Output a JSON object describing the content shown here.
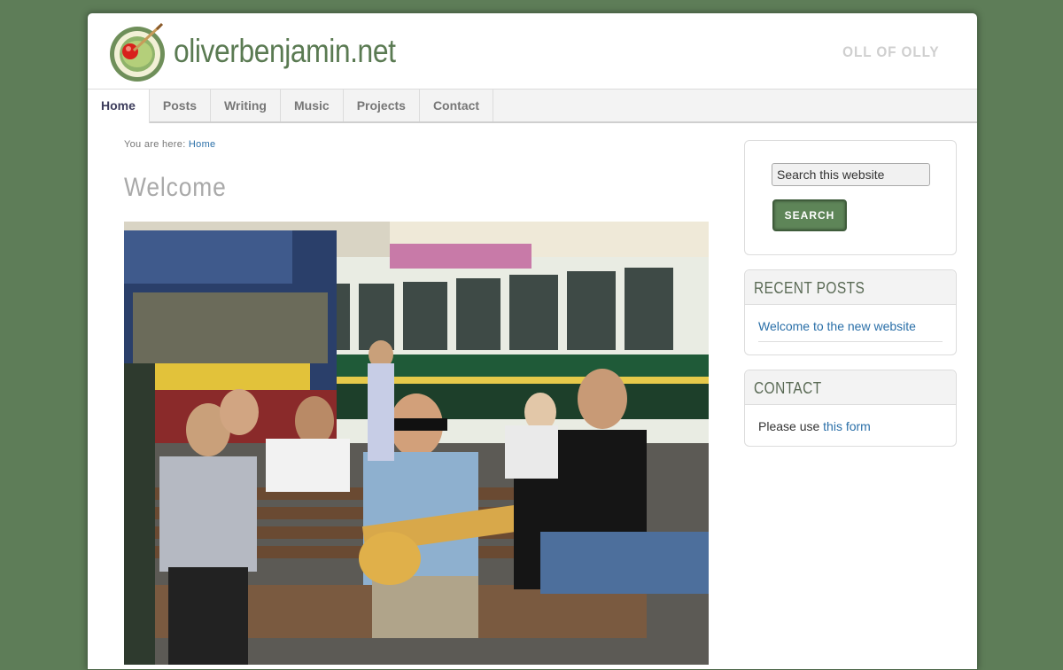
{
  "site": {
    "title": "oliverbenjamin.net",
    "tagline": "OLL OF OLLY"
  },
  "nav": {
    "items": [
      {
        "label": "Home",
        "active": true
      },
      {
        "label": "Posts"
      },
      {
        "label": "Writing"
      },
      {
        "label": "Music"
      },
      {
        "label": "Projects"
      },
      {
        "label": "Contact"
      }
    ]
  },
  "content": {
    "breadcrumb_prefix": "You are here: ",
    "breadcrumb_link": "Home",
    "page_title": "Welcome"
  },
  "sidebar": {
    "search": {
      "placeholder": "Search this website",
      "value": "Search this website",
      "button_label": "SEARCH"
    },
    "recent_posts": {
      "title": "RECENT POSTS",
      "items": [
        "Welcome to the new website"
      ]
    },
    "contact": {
      "title": "CONTACT",
      "text_prefix": "Please use ",
      "link_text": "this form"
    }
  },
  "colors": {
    "background": "#5e7d58",
    "brand_green": "#5a7a52",
    "link": "#2a6fa8",
    "button": "#5e8558"
  },
  "icons": {
    "logo": "olive-with-toothpick-logo"
  }
}
